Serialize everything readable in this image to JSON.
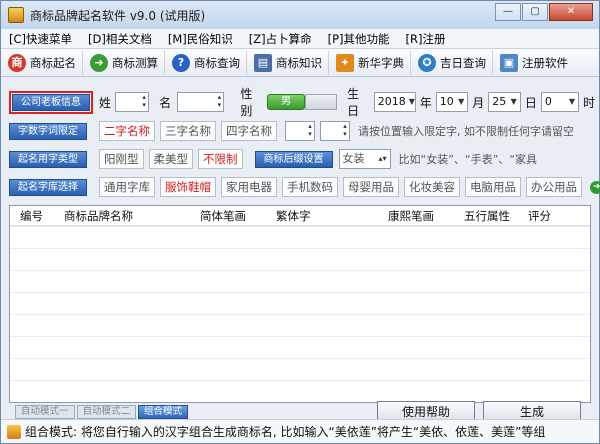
{
  "window": {
    "title": "商标品牌起名软件 v9.0 (试用版)",
    "controls": [
      "—",
      "▢",
      "✕"
    ]
  },
  "menu": [
    "[C]快速菜单",
    "[D]相关文档",
    "[M]民俗知识",
    "[Z]占卜算命",
    "[P]其他功能",
    "[R]注册"
  ],
  "toolbar": [
    {
      "label": "商标起名",
      "icon": "trademark-icon",
      "color": "#d23a2a",
      "glyph": "商"
    },
    {
      "label": "商标测算",
      "icon": "arrow-right-icon",
      "color": "#3d9b35",
      "glyph": "➜"
    },
    {
      "label": "商标查询",
      "icon": "help-icon",
      "color": "#2a62c4",
      "glyph": "?"
    },
    {
      "label": "商标知识",
      "icon": "book-icon",
      "color": "#4a6fa5",
      "glyph": "▤"
    },
    {
      "label": "新华字典",
      "icon": "windows-icon",
      "color": "#e08a1e",
      "glyph": "✦"
    },
    {
      "label": "吉日查询",
      "icon": "calendar-icon",
      "color": "#2d7fc1",
      "glyph": "✪"
    },
    {
      "label": "注册软件",
      "icon": "register-icon",
      "color": "#4f86c6",
      "glyph": "▣"
    }
  ],
  "company": {
    "button": "公司老板信息",
    "surname_label": "姓",
    "name_label": "名",
    "gender_label": "性别",
    "gender_value": "男",
    "birth_label": "生日",
    "year": "2018",
    "year_unit": "年",
    "month": "10",
    "month_unit": "月",
    "day": "25",
    "day_unit": "日",
    "hour": "0",
    "hour_unit": "时"
  },
  "row_chars": {
    "button": "字数字词限定",
    "options": [
      "二字名称",
      "三字名称",
      "四字名称"
    ],
    "hint": "请按位置输入限定字, 如不限制任何字请留空"
  },
  "row_style": {
    "button": "起名用字类型",
    "options": [
      "阳刚型",
      "柔美型",
      "不限制"
    ],
    "industry_button": "商标后缀设置",
    "industry_value": "女装",
    "hint": "比如“女装”、“手表”、“家具"
  },
  "row_library": {
    "button": "起名字库选择",
    "options": [
      "通用字库",
      "服饰鞋帽",
      "家用电器",
      "手机数码",
      "母婴用品",
      "化妆美容",
      "电脑用品",
      "办公用品"
    ]
  },
  "table": {
    "columns": [
      "编号",
      "商标品牌名称",
      "简体笔画",
      "繁体字",
      "康熙笔画",
      "五行属性",
      "评分"
    ]
  },
  "mode_tabs": [
    "自动模式一",
    "自动模式二",
    "组合模式"
  ],
  "buttons": {
    "help": "使用帮助",
    "generate": "生成"
  },
  "status": "组合模式: 将您自行输入的汉字组合生成商标名, 比如输入“美依莲”将产生“美依、依莲、美莲”等组"
}
